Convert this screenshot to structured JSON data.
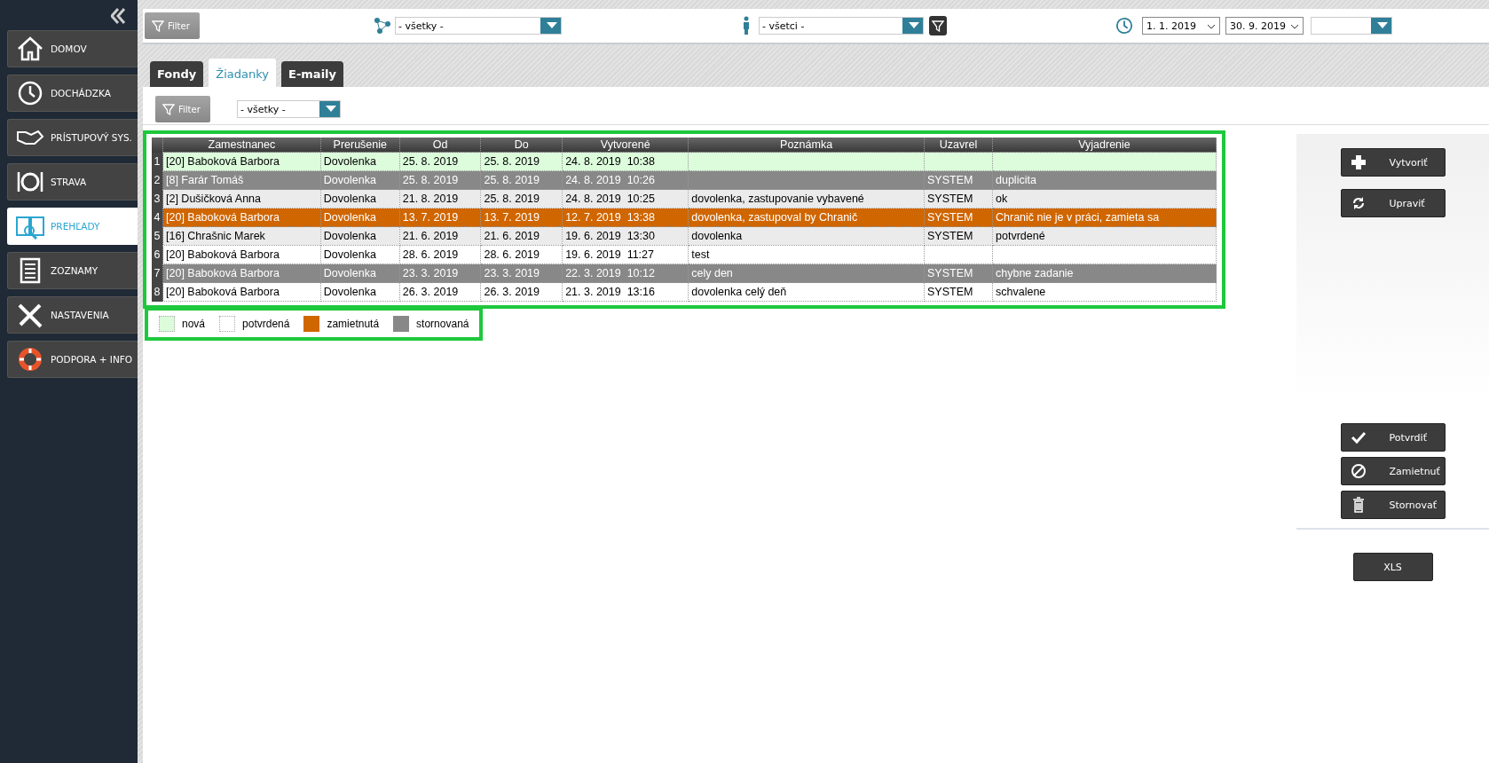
{
  "sidebar": {
    "items": [
      {
        "label": "DOMOV",
        "selected": false
      },
      {
        "label": "DOCHÁDZKA",
        "selected": false
      },
      {
        "label": "PRÍSTUPOVÝ SYS.",
        "selected": false
      },
      {
        "label": "STRAVA",
        "selected": false
      },
      {
        "label": "PREHĽADY",
        "selected": true
      },
      {
        "label": "ZOZNAMY",
        "selected": false
      },
      {
        "label": "NASTAVENIA",
        "selected": false
      },
      {
        "label": "PODPORA + INFO",
        "selected": false
      }
    ]
  },
  "toolbar": {
    "filter_button": "Filter",
    "group_select": "- všetky -",
    "person_select": "- všetci -",
    "date_from": "1. 1. 2019",
    "date_to": "30. 9. 2019"
  },
  "tabs": [
    {
      "label": "Fondy",
      "selected": false
    },
    {
      "label": "Žiadanky",
      "selected": true
    },
    {
      "label": "E-maily",
      "selected": false
    }
  ],
  "subfilter": {
    "filter_button": "Filter",
    "status_select": "- všetky -"
  },
  "table": {
    "columns": [
      "",
      "Zamestnanec",
      "Prerušenie",
      "Od",
      "Do",
      "Vytvorené",
      "Poznámka",
      "Uzavrel",
      "Vyjadrenie"
    ],
    "rows": [
      {
        "kind": "new",
        "shaded": false,
        "cells": [
          "1",
          "[20] Baboková Barbora",
          "Dovolenka",
          "25. 8. 2019",
          "25. 8. 2019",
          "24. 8. 2019  10:38",
          "",
          "",
          ""
        ]
      },
      {
        "kind": "cancelled",
        "shaded": false,
        "cells": [
          "2",
          "[8] Farár Tomáš",
          "Dovolenka",
          "25. 8. 2019",
          "25. 8. 2019",
          "24. 8. 2019  10:26",
          "",
          "SYSTEM",
          "duplicita"
        ]
      },
      {
        "kind": "confirmed",
        "shaded": true,
        "cells": [
          "3",
          "[2] Dušičková Anna",
          "Dovolenka",
          "21. 8. 2019",
          "25. 8. 2019",
          "24. 8. 2019  10:25",
          "dovolenka, zastupovanie vybavené",
          "SYSTEM",
          "ok"
        ]
      },
      {
        "kind": "rejected",
        "shaded": false,
        "cells": [
          "4",
          "[20] Baboková Barbora",
          "Dovolenka",
          "13. 7. 2019",
          "13. 7. 2019",
          "12. 7. 2019  13:38",
          "dovolenka, zastupoval by Chranič",
          "SYSTEM",
          "Chranič nie je v práci, zamieta sa"
        ]
      },
      {
        "kind": "confirmed",
        "shaded": true,
        "cells": [
          "5",
          "[16] Chrašnic Marek",
          "Dovolenka",
          "21. 6. 2019",
          "21. 6. 2019",
          "19. 6. 2019  13:30",
          "dovolenka",
          "SYSTEM",
          "potvrdené"
        ]
      },
      {
        "kind": "confirmed",
        "shaded": false,
        "cells": [
          "6",
          "[20] Baboková Barbora",
          "Dovolenka",
          "28. 6. 2019",
          "28. 6. 2019",
          "19. 6. 2019  11:27",
          "test",
          "",
          ""
        ]
      },
      {
        "kind": "cancelled",
        "shaded": false,
        "cells": [
          "7",
          "[20] Baboková Barbora",
          "Dovolenka",
          "23. 3. 2019",
          "23. 3. 2019",
          "22. 3. 2019  10:12",
          "cely den",
          "SYSTEM",
          "chybne zadanie"
        ]
      },
      {
        "kind": "confirmed",
        "shaded": false,
        "cells": [
          "8",
          "[20] Baboková Barbora",
          "Dovolenka",
          "26. 3. 2019",
          "26. 3. 2019",
          "21. 3. 2019  13:16",
          "dovolenka celý deň",
          "SYSTEM",
          "schvalene"
        ]
      }
    ]
  },
  "actions": [
    "Vytvoriť",
    "Upraviť",
    "Potvrdiť",
    "Zamietnuť",
    "Stornovať"
  ],
  "export_button": "XLS",
  "legend": [
    {
      "kind": "new",
      "label": "nová",
      "color": "#dcfcdc"
    },
    {
      "kind": "confirmed",
      "label": "potvrdená",
      "color": "#ffffff"
    },
    {
      "kind": "rejected",
      "label": "zamietnutá",
      "color": "#d06600"
    },
    {
      "kind": "cancelled",
      "label": "stornovaná",
      "color": "#888888"
    }
  ]
}
